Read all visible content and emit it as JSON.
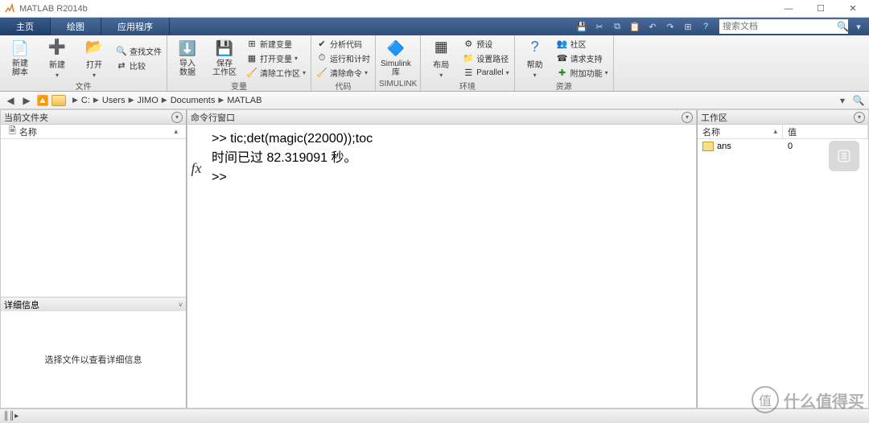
{
  "window": {
    "title": "MATLAB R2014b"
  },
  "tabs": [
    "主页",
    "绘图",
    "应用程序"
  ],
  "searchdoc_placeholder": "搜索文档",
  "ribbon": {
    "file": {
      "new_script": "新建\n脚本",
      "new": "新建",
      "open": "打开",
      "find_files": "查找文件",
      "compare": "比较",
      "label": "文件"
    },
    "var": {
      "import": "导入\n数据",
      "save_ws": "保存\n工作区",
      "new_var": "新建变量",
      "open_var": "打开变量",
      "clear_ws": "清除工作区",
      "label": "变量"
    },
    "code": {
      "analyze": "分析代码",
      "runtime": "运行和计时",
      "clear_cmd": "清除命令",
      "label": "代码"
    },
    "simulink": {
      "lib": "Simulink\n库",
      "label": "SIMULINK"
    },
    "env": {
      "layout": "布局",
      "prefs": "预设",
      "setpath": "设置路径",
      "parallel": "Parallel",
      "label": "环境"
    },
    "res": {
      "help": "帮助",
      "community": "社区",
      "support": "请求支持",
      "addons": "附加功能",
      "label": "资源"
    }
  },
  "breadcrumb": [
    "C:",
    "Users",
    "JIMO",
    "Documents",
    "MATLAB"
  ],
  "panes": {
    "current_folder": {
      "title": "当前文件夹",
      "col_name": "名称",
      "details_title": "详细信息",
      "details_msg": "选择文件以查看详细信息"
    },
    "command_window": {
      "title": "命令行窗口",
      "lines": [
        ">> tic;det(magic(22000));toc",
        "时间已过 82.319091 秒。",
        ">> "
      ]
    },
    "workspace": {
      "title": "工作区",
      "col_name": "名称",
      "col_value": "值",
      "rows": [
        {
          "name": "ans",
          "value": "0"
        }
      ]
    }
  },
  "watermark": "什么值得买"
}
